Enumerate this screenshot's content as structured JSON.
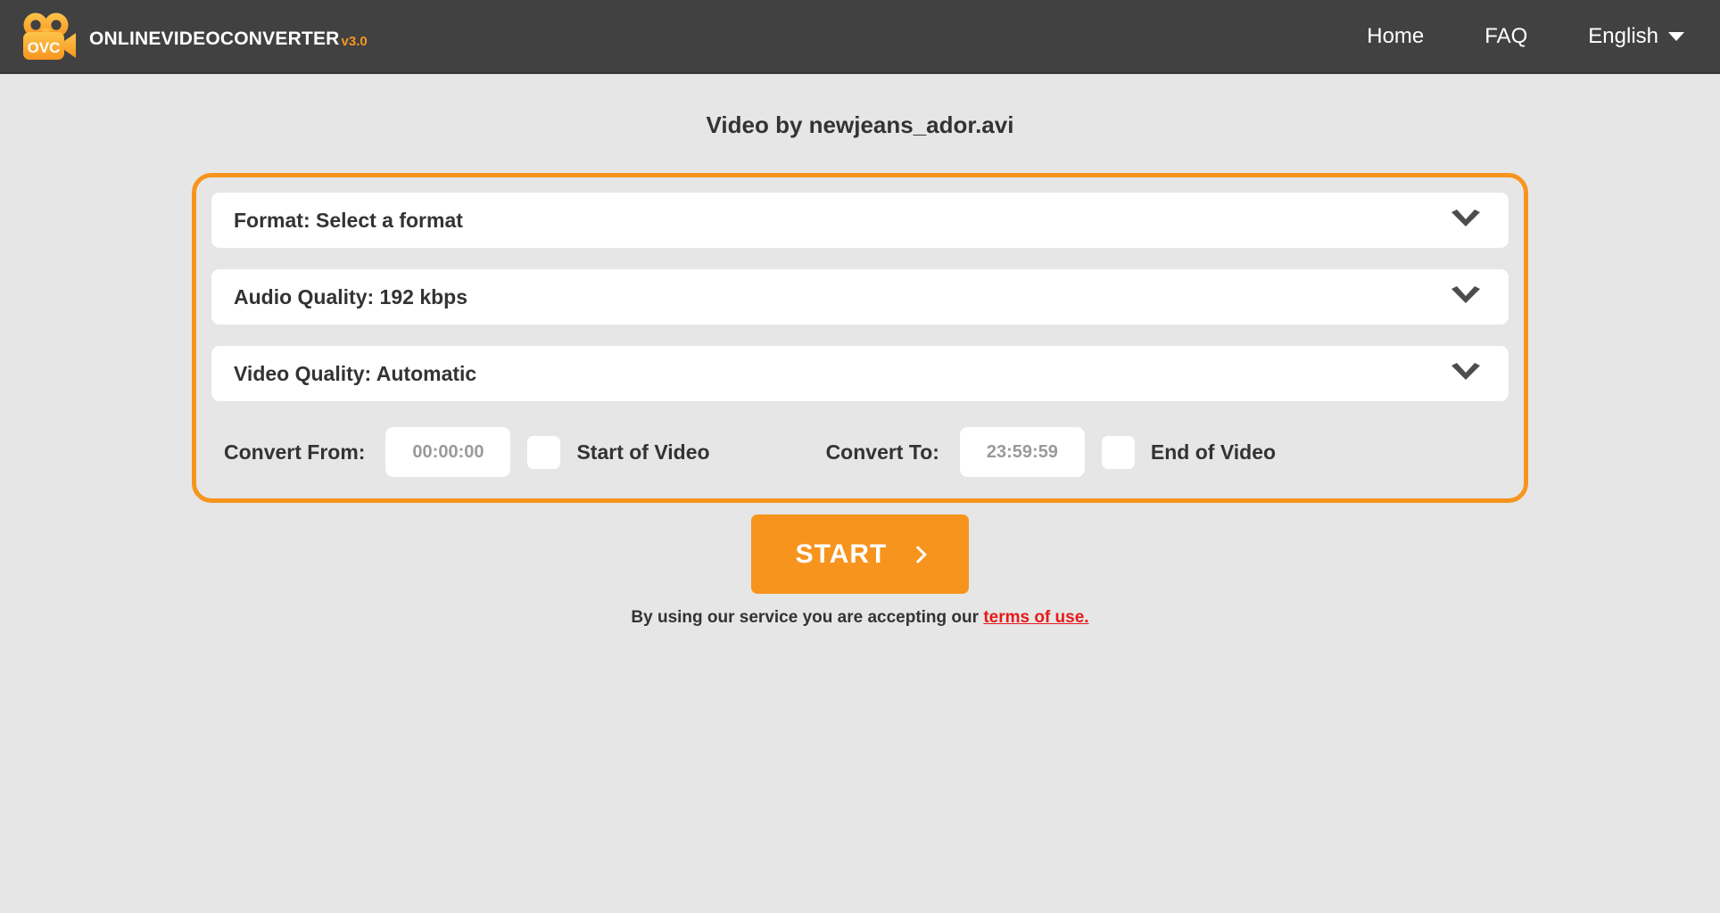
{
  "header": {
    "logo_icon": "video-camera-icon",
    "logo_badge_text": "OVC",
    "wordmark": "OnlineVideoConverter",
    "version": "v3.0",
    "nav": [
      {
        "label": "Home",
        "icon": null
      },
      {
        "label": "FAQ",
        "icon": null
      },
      {
        "label": "English",
        "icon": "chevron-down-icon"
      }
    ]
  },
  "main": {
    "page_title": "Video by newjeans_ador.avi",
    "selects": [
      {
        "label": "Format: Select a format",
        "name": "format",
        "icon": "chevron-down-icon"
      },
      {
        "label": "Audio Quality: 192 kbps",
        "name": "audio-quality",
        "icon": "chevron-down-icon"
      },
      {
        "label": "Video Quality: Automatic",
        "name": "video-quality",
        "icon": "chevron-down-icon"
      }
    ],
    "range": {
      "from_label": "Convert From:",
      "from_value": "",
      "from_placeholder": "00:00:00",
      "from_checkbox_label": "Start of Video",
      "from_checked": false,
      "to_label": "Convert To:",
      "to_value": "",
      "to_placeholder": "23:59:59",
      "to_checkbox_label": "End of Video",
      "to_checked": false
    },
    "start_button": "START",
    "start_icon": "chevron-right-icon",
    "terms_prefix": "By using our service you are accepting our ",
    "terms_link": "terms of use."
  },
  "colors": {
    "header_bg": "#414141",
    "page_bg": "#e6e6e6",
    "accent_orange": "#f7941e",
    "logo_orange": "#fbb034",
    "link_red": "#e8191b",
    "text_dark": "#333333",
    "placeholder_gray": "#9a9a9a"
  }
}
